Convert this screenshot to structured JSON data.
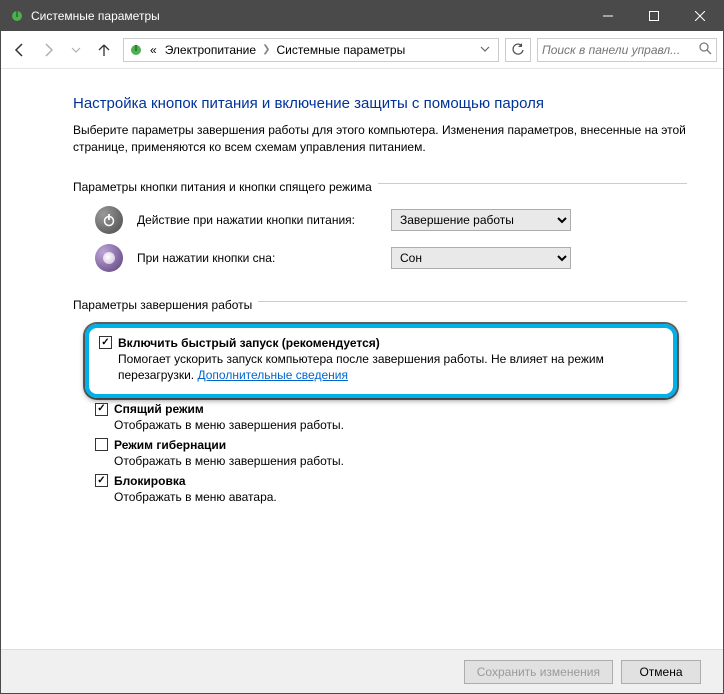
{
  "window": {
    "title": "Системные параметры"
  },
  "breadcrumb": {
    "prefix": "«",
    "items": [
      "Электропитание",
      "Системные параметры"
    ]
  },
  "search": {
    "placeholder": "Поиск в панели управл..."
  },
  "page": {
    "title": "Настройка кнопок питания и включение защиты с помощью пароля",
    "description": "Выберите параметры завершения работы для этого компьютера. Изменения параметров, внесенные на этой странице, применяются ко всем схемам управления питанием."
  },
  "section_buttons": {
    "label": "Параметры кнопки питания и кнопки спящего режима",
    "power_row": {
      "label": "Действие при нажатии кнопки питания:",
      "value": "Завершение работы"
    },
    "sleep_row": {
      "label": "При нажатии кнопки сна:",
      "value": "Сон"
    }
  },
  "section_shutdown": {
    "label": "Параметры завершения работы",
    "items": [
      {
        "checked": true,
        "highlighted": true,
        "title": "Включить быстрый запуск (рекомендуется)",
        "desc": "Помогает ускорить запуск компьютера после завершения работы. Не влияет на режим перезагрузки.",
        "link": "Дополнительные сведения"
      },
      {
        "checked": true,
        "title": "Спящий режим",
        "desc": "Отображать в меню завершения работы."
      },
      {
        "checked": false,
        "title": "Режим гибернации",
        "desc": "Отображать в меню завершения работы."
      },
      {
        "checked": true,
        "title": "Блокировка",
        "desc": "Отображать в меню аватара."
      }
    ]
  },
  "footer": {
    "save": "Сохранить изменения",
    "cancel": "Отмена"
  }
}
